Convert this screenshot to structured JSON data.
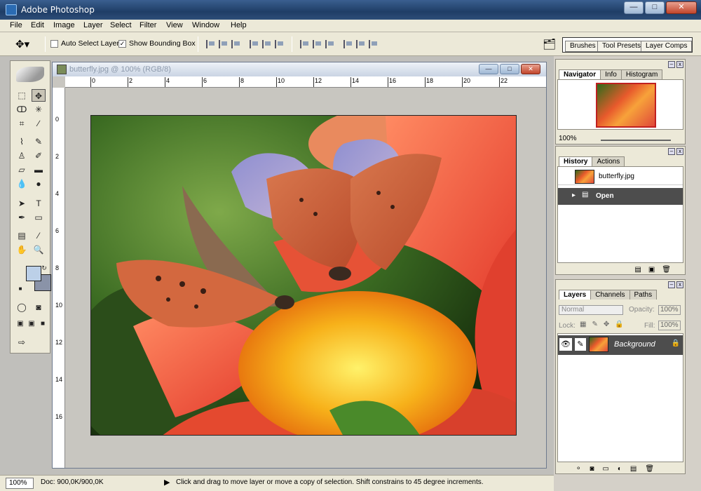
{
  "window": {
    "title": "Adobe Photoshop",
    "min": "—",
    "max": "□",
    "close": "✕"
  },
  "menu": [
    "File",
    "Edit",
    "Image",
    "Layer",
    "Select",
    "Filter",
    "View",
    "Window",
    "Help"
  ],
  "options": {
    "auto_select": "Auto Select Layer",
    "show_bounding": "Show Bounding Box",
    "well_tabs": [
      "Brushes",
      "Tool Presets",
      "Layer Comps"
    ]
  },
  "document": {
    "title": "butterfly.jpg @ 100% (RGB/8)",
    "h_ruler": [
      "0",
      "2",
      "4",
      "6",
      "8",
      "10",
      "12",
      "14",
      "16",
      "18",
      "20",
      "22"
    ],
    "v_ruler": [
      "0",
      "2",
      "4",
      "6",
      "8",
      "10",
      "12",
      "14",
      "16"
    ]
  },
  "status": {
    "zoom": "100%",
    "doc": "Doc: 900,0K/900,0K",
    "hint": "Click and drag to move layer or move a copy of selection. Shift constrains to 45 degree increments."
  },
  "navigator": {
    "tabs": [
      "Navigator",
      "Info",
      "Histogram"
    ],
    "zoom": "100%"
  },
  "history": {
    "tabs": [
      "History",
      "Actions"
    ],
    "snapshot": "butterfly.jpg",
    "states": [
      "Open"
    ]
  },
  "layers": {
    "tabs": [
      "Layers",
      "Channels",
      "Paths"
    ],
    "blend": "Normal",
    "opacity_label": "Opacity:",
    "opacity": "100%",
    "lock_label": "Lock:",
    "fill_label": "Fill:",
    "fill": "100%",
    "items": [
      {
        "name": "Background"
      }
    ]
  },
  "colors": {
    "foreground": "#bcd0e8",
    "background": "#8a93a8"
  }
}
